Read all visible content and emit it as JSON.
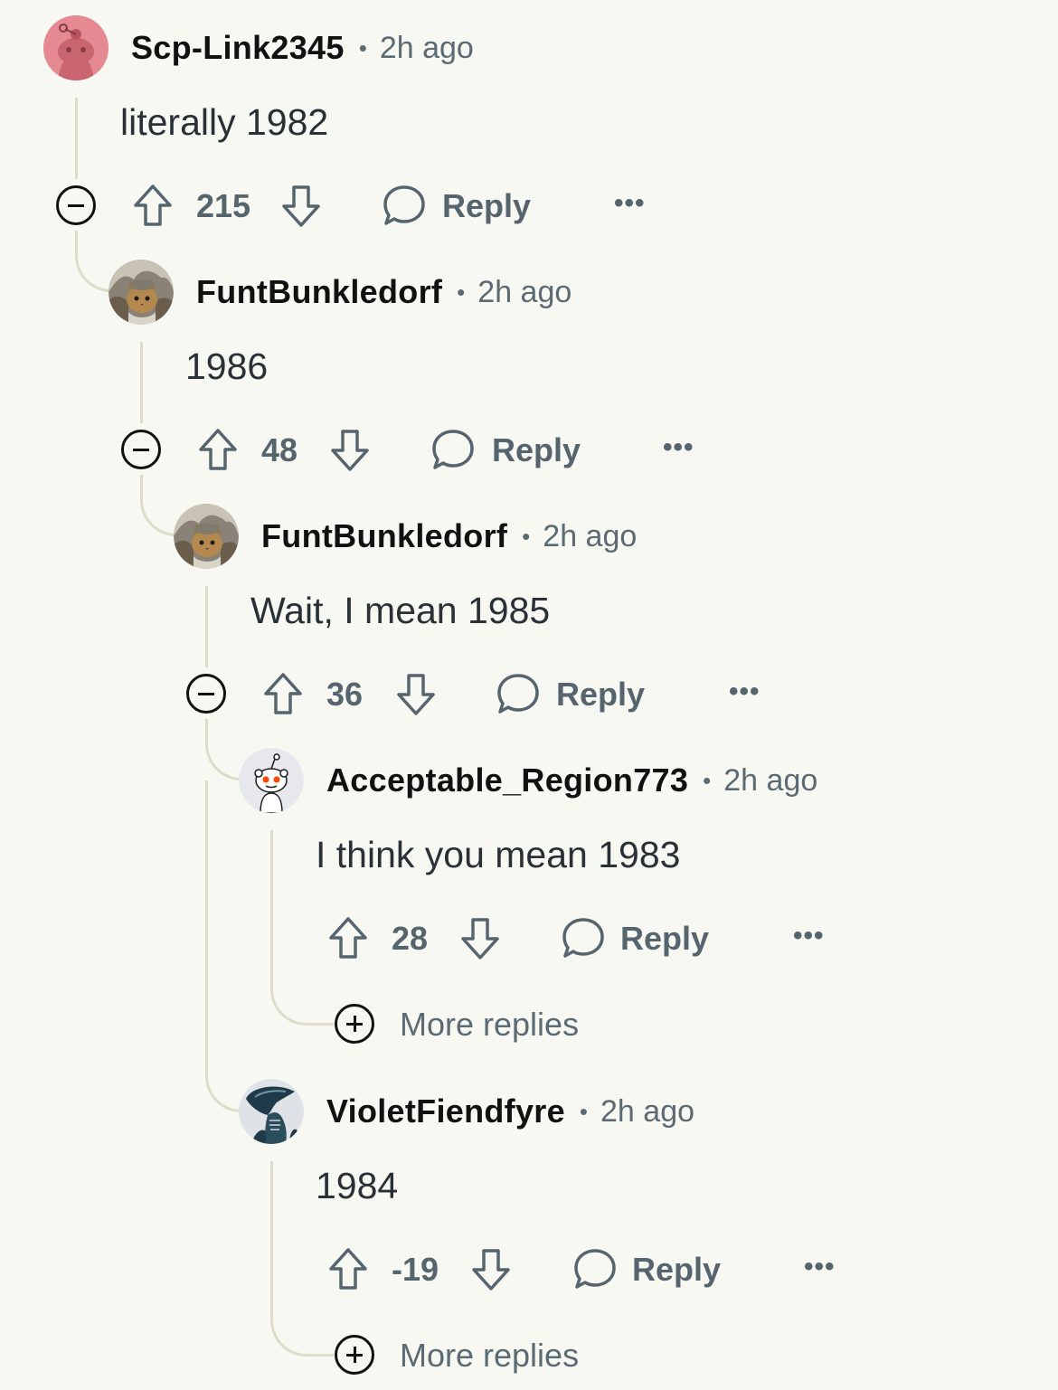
{
  "comments": [
    {
      "username": "Scp-Link2345",
      "time": "2h ago",
      "text": "literally 1982",
      "score": "215",
      "reply_label": "Reply",
      "avatar": "snoo-pink-avatar"
    },
    {
      "username": "FuntBunkledorf",
      "time": "2h ago",
      "text": "1986",
      "score": "48",
      "reply_label": "Reply",
      "avatar": "cat-photo-avatar"
    },
    {
      "username": "FuntBunkledorf",
      "time": "2h ago",
      "text": "Wait, I mean 1985",
      "score": "36",
      "reply_label": "Reply",
      "avatar": "cat-photo-avatar"
    },
    {
      "username": "Acceptable_Region773",
      "time": "2h ago",
      "text": "I think you mean 1983",
      "score": "28",
      "reply_label": "Reply",
      "avatar": "snoo-white-avatar"
    },
    {
      "username": "VioletFiendfyre",
      "time": "2h ago",
      "text": "1984",
      "score": "-19",
      "reply_label": "Reply",
      "avatar": "alien-avatar"
    }
  ],
  "more_replies": [
    "More replies",
    "More replies"
  ],
  "icons": {
    "collapse": "collapse-icon",
    "upvote": "upvote-arrow-icon",
    "downvote": "downvote-arrow-icon",
    "reply": "speech-bubble-icon",
    "more": "ellipsis-icon",
    "expand": "plus-circle-icon"
  },
  "colors": {
    "background": "#f8f8f3",
    "meta": "#5c6b73",
    "thread_line": "#dcdcc8",
    "avatar_pink": "#e58a92"
  }
}
